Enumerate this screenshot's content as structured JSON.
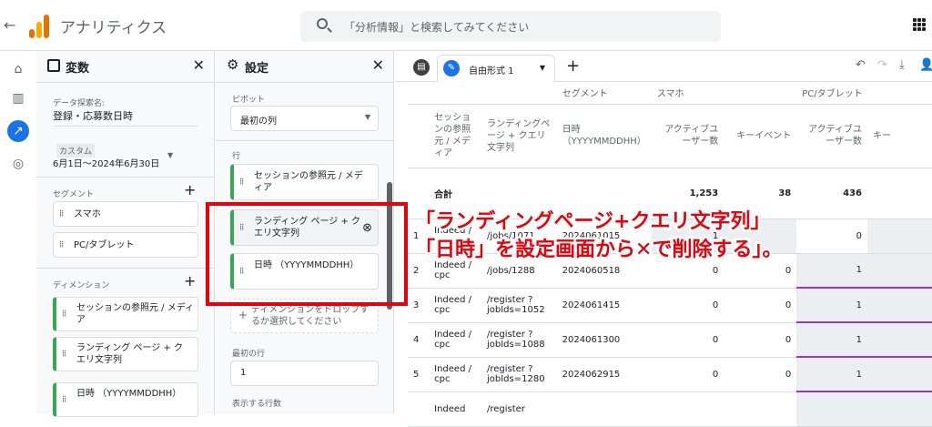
{
  "topbar": {
    "app_title": "アナリティクス",
    "search_placeholder": "「分析情報」と検索してみてください"
  },
  "vars_panel": {
    "title": "変数",
    "exploration_name_label": "データ探索名:",
    "exploration_name": "登録・応募数日時",
    "date_label": "カスタム",
    "date_range": "6月1日～2024年6月30日",
    "segments_label": "セグメント",
    "segments": [
      "スマホ",
      "PC/タブレット"
    ],
    "dimensions_label": "ディメンション",
    "dimensions": [
      "セッションの参照元 / メディア",
      "ランディング ページ + クエリ文字列",
      "日時 （YYYYMMDDHH）"
    ]
  },
  "settings_panel": {
    "title": "設定",
    "pivot_label": "ピボット",
    "pivot_value": "最初の列",
    "rows_label": "行",
    "rows": [
      "セッションの参照元 / メディア",
      "ランディング ページ + クエリ文字列",
      "日時 （YYYYMMDDHH）"
    ],
    "drop_hint": "ディメンションをドロップするか選択してください",
    "first_row_label": "最初の行",
    "first_row_value": "1",
    "show_rows_label": "表示する行数"
  },
  "tabs": {
    "active_label": "自由形式 1"
  },
  "table": {
    "segment_header": "セグメント",
    "segments": [
      "スマホ",
      "PC/タブレット"
    ],
    "dim_headers": [
      "セッションの参照元 / メディア",
      "ランディングページ + クエリ文字列",
      "日時（YYYYMMDDHH）"
    ],
    "metric_headers": [
      "アクティブユーザー数",
      "キーイベント",
      "アクティブユーザー数",
      "キー"
    ],
    "total_label": "合計",
    "totals": [
      "1,253",
      "38",
      "436",
      ""
    ],
    "rows": [
      {
        "n": "1",
        "src": "Indeed / cpc",
        "lp": "/jobs/1071",
        "dt": "2024061015",
        "v": [
          "1",
          "",
          "0",
          ""
        ]
      },
      {
        "n": "2",
        "src": "Indeed / cpc",
        "lp": "/jobs/1288",
        "dt": "2024060518",
        "v": [
          "0",
          "0",
          "1",
          ""
        ]
      },
      {
        "n": "3",
        "src": "Indeed / cpc",
        "lp": "/register ?jobIds=1052",
        "dt": "2024061415",
        "v": [
          "0",
          "0",
          "1",
          ""
        ]
      },
      {
        "n": "4",
        "src": "Indeed / cpc",
        "lp": "/register ?jobIds=1088",
        "dt": "2024061300",
        "v": [
          "0",
          "0",
          "1",
          ""
        ]
      },
      {
        "n": "5",
        "src": "Indeed / cpc",
        "lp": "/register ?jobIds=1280",
        "dt": "2024062915",
        "v": [
          "0",
          "0",
          "1",
          ""
        ]
      },
      {
        "n": "",
        "src": "Indeed",
        "lp": "/register",
        "dt": "",
        "v": [
          "",
          "",
          "",
          ""
        ]
      }
    ]
  },
  "annotation": {
    "line1": "「ランディングページ+クエリ文字列」",
    "line2_a": "「日時」を設定画面から",
    "line2_x": "✕",
    "line2_b": "で削除する」。"
  },
  "colors": {
    "accent": "#1a73e8",
    "callout_red": "#e8000b",
    "dimension_green": "#34a853",
    "bar_purple": "#9334e6"
  }
}
